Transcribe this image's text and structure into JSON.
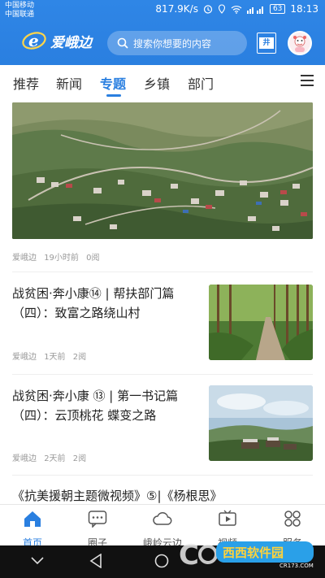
{
  "status": {
    "carrier1": "中国移动",
    "carrier2": "中国联通",
    "speed": "817.9K/s",
    "battery": "63",
    "time": "18:13",
    "icons": [
      "alarm-icon",
      "wifi-icon",
      "signal-icon"
    ]
  },
  "appbar": {
    "logo_text": "爱峨边",
    "search_placeholder": "搜索你想要的内容",
    "channel_button_label": "井"
  },
  "tabs": [
    {
      "label": "推荐",
      "active": false
    },
    {
      "label": "新闻",
      "active": false
    },
    {
      "label": "专题",
      "active": true
    },
    {
      "label": "乡镇",
      "active": false
    },
    {
      "label": "部门",
      "active": false
    }
  ],
  "articles": [
    {
      "type": "large-image",
      "source": "爱峨边",
      "time": "19小时前",
      "reads": "0阅"
    },
    {
      "type": "text-image",
      "title": "战贫困·奔小康⑭ | 帮扶部门篇（四）：致富之路绕山村",
      "source": "爱峨边",
      "time": "1天前",
      "reads": "2阅"
    },
    {
      "type": "text-image",
      "title": "战贫困·奔小康 ⑬ | 第一书记篇（四）：云顶桃花 蝶变之路",
      "source": "爱峨边",
      "time": "2天前",
      "reads": "2阅"
    },
    {
      "type": "text",
      "title": "《抗美援朝主题微视频》⑤|《杨根思》"
    }
  ],
  "bottom_nav": [
    {
      "label": "首页",
      "icon": "home-icon",
      "active": true
    },
    {
      "label": "圈子",
      "icon": "chat-icon",
      "active": false
    },
    {
      "label": "峨岭云边",
      "icon": "cloud-icon",
      "active": false
    },
    {
      "label": "视频",
      "icon": "video-icon",
      "active": false
    },
    {
      "label": "服务",
      "icon": "services-icon",
      "active": false
    }
  ],
  "watermark": {
    "text": "西西软件园",
    "url_text": "CR173.COM"
  },
  "colors": {
    "brand": "#2a7fe0",
    "header_bg": "#2f86e6"
  }
}
